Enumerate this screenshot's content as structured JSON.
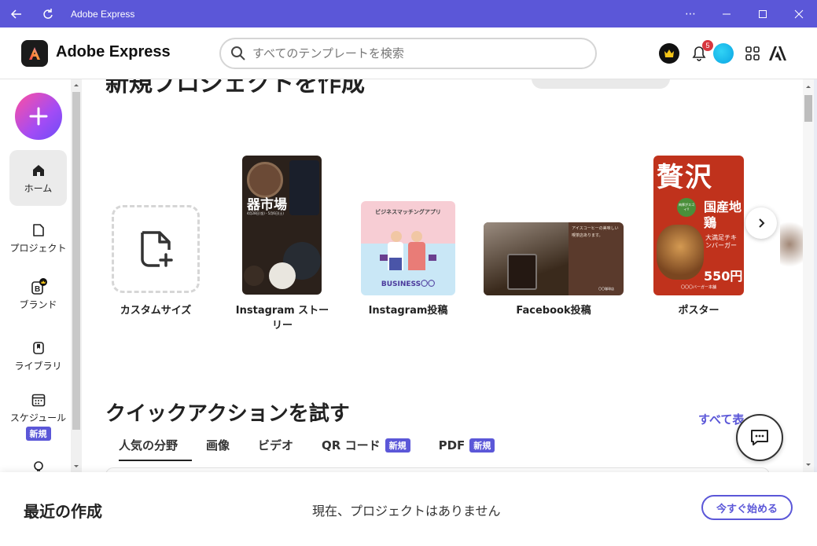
{
  "window": {
    "title": "Adobe Express",
    "more_label": "⋯"
  },
  "header": {
    "brand": "Adobe Express",
    "search_placeholder": "すべてのテンプレートを検索",
    "notification_count": "5"
  },
  "sidebar": {
    "items": [
      {
        "label": "ホーム",
        "icon": "home-icon"
      },
      {
        "label": "プロジェクト",
        "icon": "file-icon"
      },
      {
        "label": "ブランド",
        "icon": "brand-icon"
      },
      {
        "label": "ライブラリ",
        "icon": "library-icon"
      },
      {
        "label": "スケジュール",
        "icon": "calendar-icon",
        "badge": "新規"
      }
    ]
  },
  "create_section": {
    "heading_cut": "新規プロジェクトを作成",
    "tiles": [
      {
        "label": "カスタムサイズ"
      },
      {
        "label": "Instagram ストーリー",
        "thumb_text": "器市場",
        "thumb_sub": "4月28日(金) - 5月6日(土)"
      },
      {
        "label": "Instagram投稿",
        "thumb_text": "ビジネスマッチングアプリ",
        "thumb_sub": "BUSINESS〇〇"
      },
      {
        "label": "Facebook投稿",
        "thumb_text": "アイスコーヒーの美味しい喫茶店あります。",
        "thumb_sub": "〇〇珈琲店"
      },
      {
        "label": "ポスター",
        "thumb_text": "贅沢",
        "thumb_mid": "国産地鶏",
        "thumb_small": "大満足チキンバーガー",
        "thumb_price": "550円",
        "thumb_bubble": "肉厚がスゴイ!!",
        "thumb_footer": "〇〇〇バーガー本舗"
      }
    ]
  },
  "quick_actions": {
    "title": "クイックアクションを試す",
    "see_all": "すべて表",
    "tabs": [
      {
        "label": "人気の分野",
        "active": true
      },
      {
        "label": "画像"
      },
      {
        "label": "ビデオ"
      },
      {
        "label": "QR コード",
        "badge": "新規"
      },
      {
        "label": "PDF",
        "badge": "新規"
      }
    ]
  },
  "recent": {
    "title": "最近の作成",
    "empty_message": "現在、プロジェクトはありません",
    "start_button": "今すぐ始める"
  },
  "colors": {
    "accent": "#5b57d8",
    "titlebar": "#5b57d8",
    "badge_red": "#d7373f"
  }
}
